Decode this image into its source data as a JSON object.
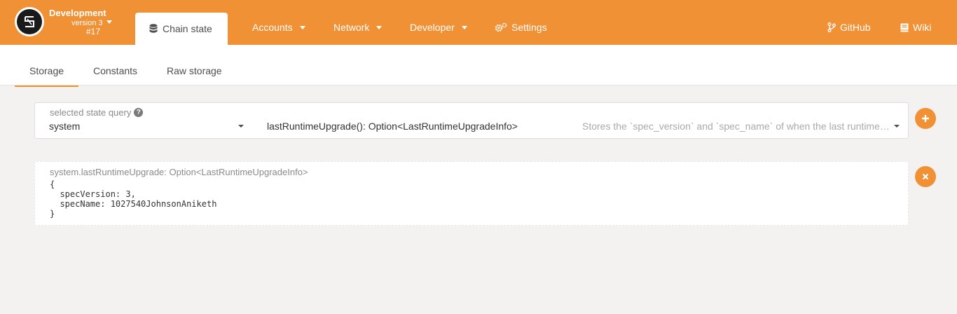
{
  "header": {
    "chain_name": "Development",
    "chain_version": "version 3",
    "chain_block": "#17",
    "active_tab": "Chain state",
    "nav": [
      {
        "label": "Accounts"
      },
      {
        "label": "Network"
      },
      {
        "label": "Developer"
      },
      {
        "label": "Settings"
      }
    ],
    "github": "GitHub",
    "wiki": "Wiki"
  },
  "subnav": {
    "tabs": [
      "Storage",
      "Constants",
      "Raw storage"
    ],
    "active": "Storage"
  },
  "query": {
    "label": "selected state query",
    "module": "system",
    "method": "lastRuntimeUpgrade(): Option<LastRuntimeUpgradeInfo>",
    "description": "Stores the `spec_version` and `spec_name` of when the last runtime upgrade happened."
  },
  "result": {
    "label": "system.lastRuntimeUpgrade: Option<LastRuntimeUpgradeInfo>",
    "code": "{\n  specVersion: 3,\n  specName: 1027540JohnsonAniketh\n}"
  },
  "colors": {
    "accent": "#f19135",
    "background": "#f3f2f1"
  },
  "icons": {
    "logo": "substrate-logo-icon",
    "chain_state": "database-icon",
    "settings": "gears-icon",
    "github": "git-branch-icon",
    "wiki": "book-icon",
    "add": "plus-icon",
    "remove": "close-icon"
  }
}
